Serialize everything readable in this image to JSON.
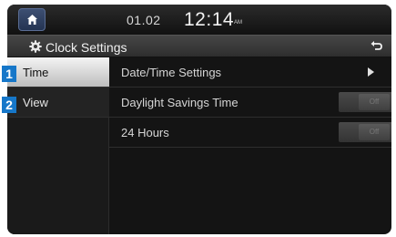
{
  "status": {
    "date": "01.02",
    "time": "12:14",
    "ampm": "AM"
  },
  "header": {
    "title": "Clock Settings"
  },
  "tabs": [
    {
      "marker": "1",
      "label": "Time",
      "selected": true
    },
    {
      "marker": "2",
      "label": "View",
      "selected": false
    }
  ],
  "settings": [
    {
      "label": "Date/Time Settings",
      "control": "arrow"
    },
    {
      "label": "Daylight Savings Time",
      "control": "toggle",
      "value": "Off"
    },
    {
      "label": "24 Hours",
      "control": "toggle",
      "value": "Off"
    }
  ],
  "colors": {
    "marker": "#1677c9",
    "active_tab": "#e0e0e0",
    "background": "#141414"
  },
  "icons": {
    "home": "home-icon",
    "settings": "gear-icon",
    "back": "back-arrow-icon",
    "forward": "chevron-right-icon"
  }
}
